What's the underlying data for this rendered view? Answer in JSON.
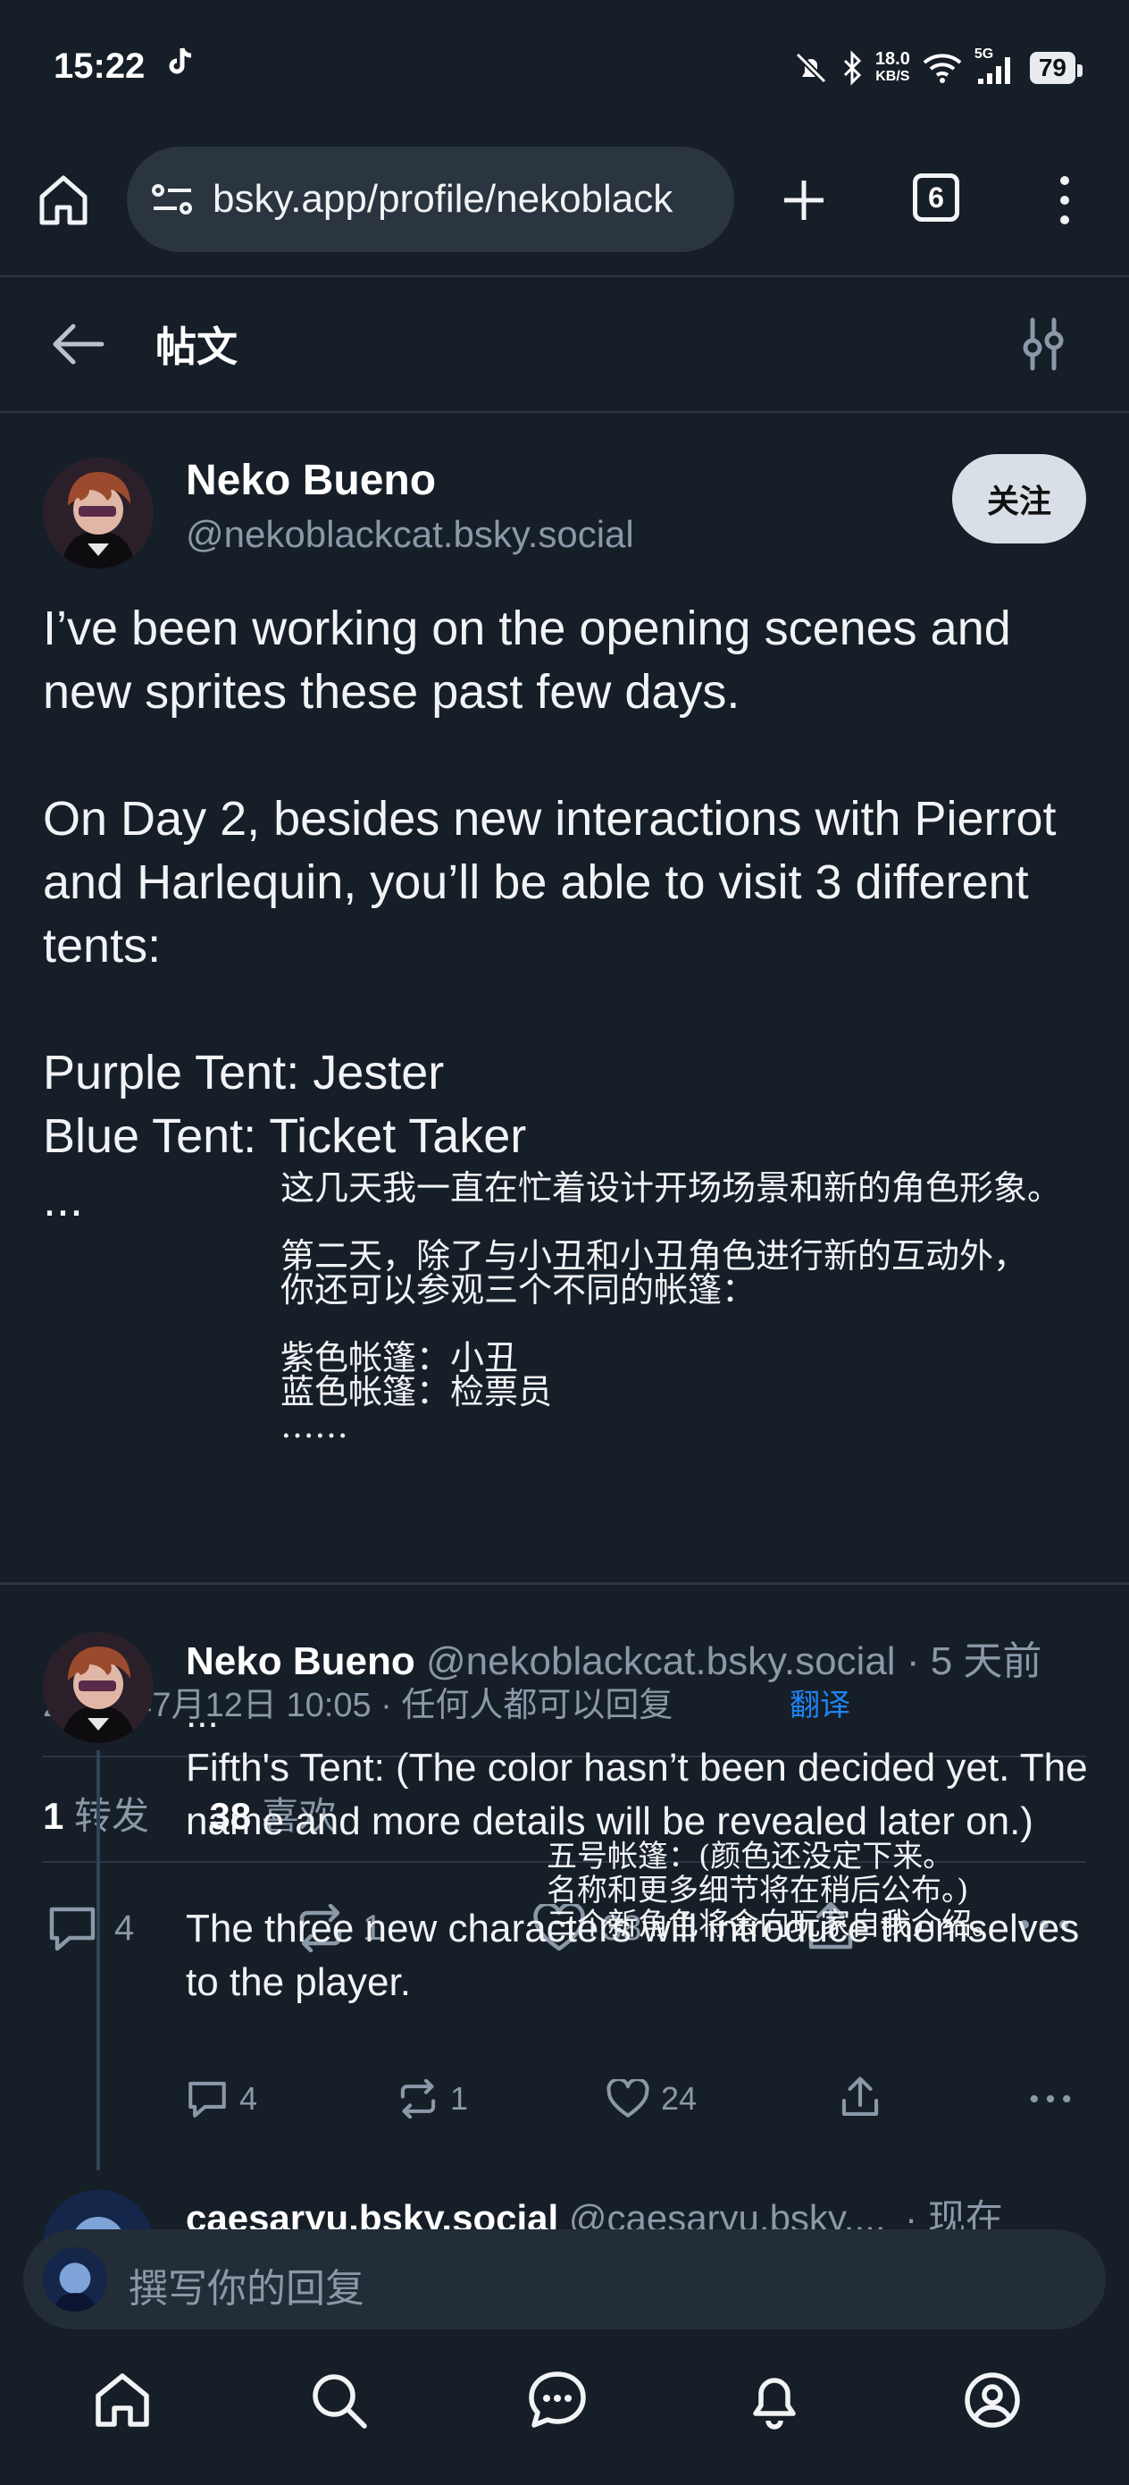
{
  "status_bar": {
    "time": "15:22",
    "net_speed_value": "18.0",
    "net_speed_unit": "KB/S",
    "network_type": "5G",
    "battery": "79",
    "icons": [
      "tiktok-icon",
      "mute-icon",
      "bluetooth-icon",
      "wifi-icon",
      "signal-icon",
      "battery-icon"
    ]
  },
  "browser": {
    "url": "bsky.app/profile/nekoblack",
    "tab_count": "6"
  },
  "header": {
    "title": "帖文"
  },
  "post": {
    "author_name": "Neko Bueno",
    "author_handle": "@nekoblackcat.bsky.social",
    "follow_label": "关注",
    "body": "I’ve been working on the opening scenes and new sprites these past few days.\n\nOn Day 2, besides new interactions with Pierrot and Harlequin, you’ll be able to visit 3 different tents:\n\nPurple Tent: Jester\nBlue Tent: Ticket Taker\n...",
    "overlay_translation": "这几天我一直在忙着设计开场场景和新的角色形象。\n\n第二天，除了与小丑和小丑角色进行新的互动外，\n你还可以参观三个不同的帐篷：\n\n紫色帐篷：小丑\n蓝色帐篷：检票员\n……",
    "date": "2025年7月12日 10:05 · 任何人都可以回复",
    "translate_label": "翻译",
    "reposts_count": "1",
    "reposts_label": "转发",
    "likes_count": "38",
    "likes_label": "喜欢",
    "actions": {
      "replies": "4",
      "reposts": "1",
      "likes": "38"
    }
  },
  "reply1": {
    "author_name": "Neko Bueno",
    "author_handle": "@nekoblackcat.bsky.social",
    "time": "· 5 天前",
    "body": "...\nFifth's Tent: (The color hasn’t been decided yet. The name and more details will be revealed later on.)\n\nThe three new characters will introduce themselves to the player.",
    "overlay_translation": "五号帐篷：(颜色还没定下来。\n名称和更多细节将在稍后公布。)\n三个新角色将会向玩家自我介绍。",
    "actions": {
      "replies": "4",
      "reposts": "1",
      "likes": "24"
    }
  },
  "reply2": {
    "author_name": "caesaryu.bsky.social",
    "author_handle": "@caesaryu.bsky....",
    "time": "· 现在"
  },
  "compose": {
    "placeholder": "撰写你的回复"
  },
  "bottom_nav": {
    "items": [
      "home-icon",
      "search-icon",
      "chat-icon",
      "bell-icon",
      "profile-icon"
    ]
  }
}
